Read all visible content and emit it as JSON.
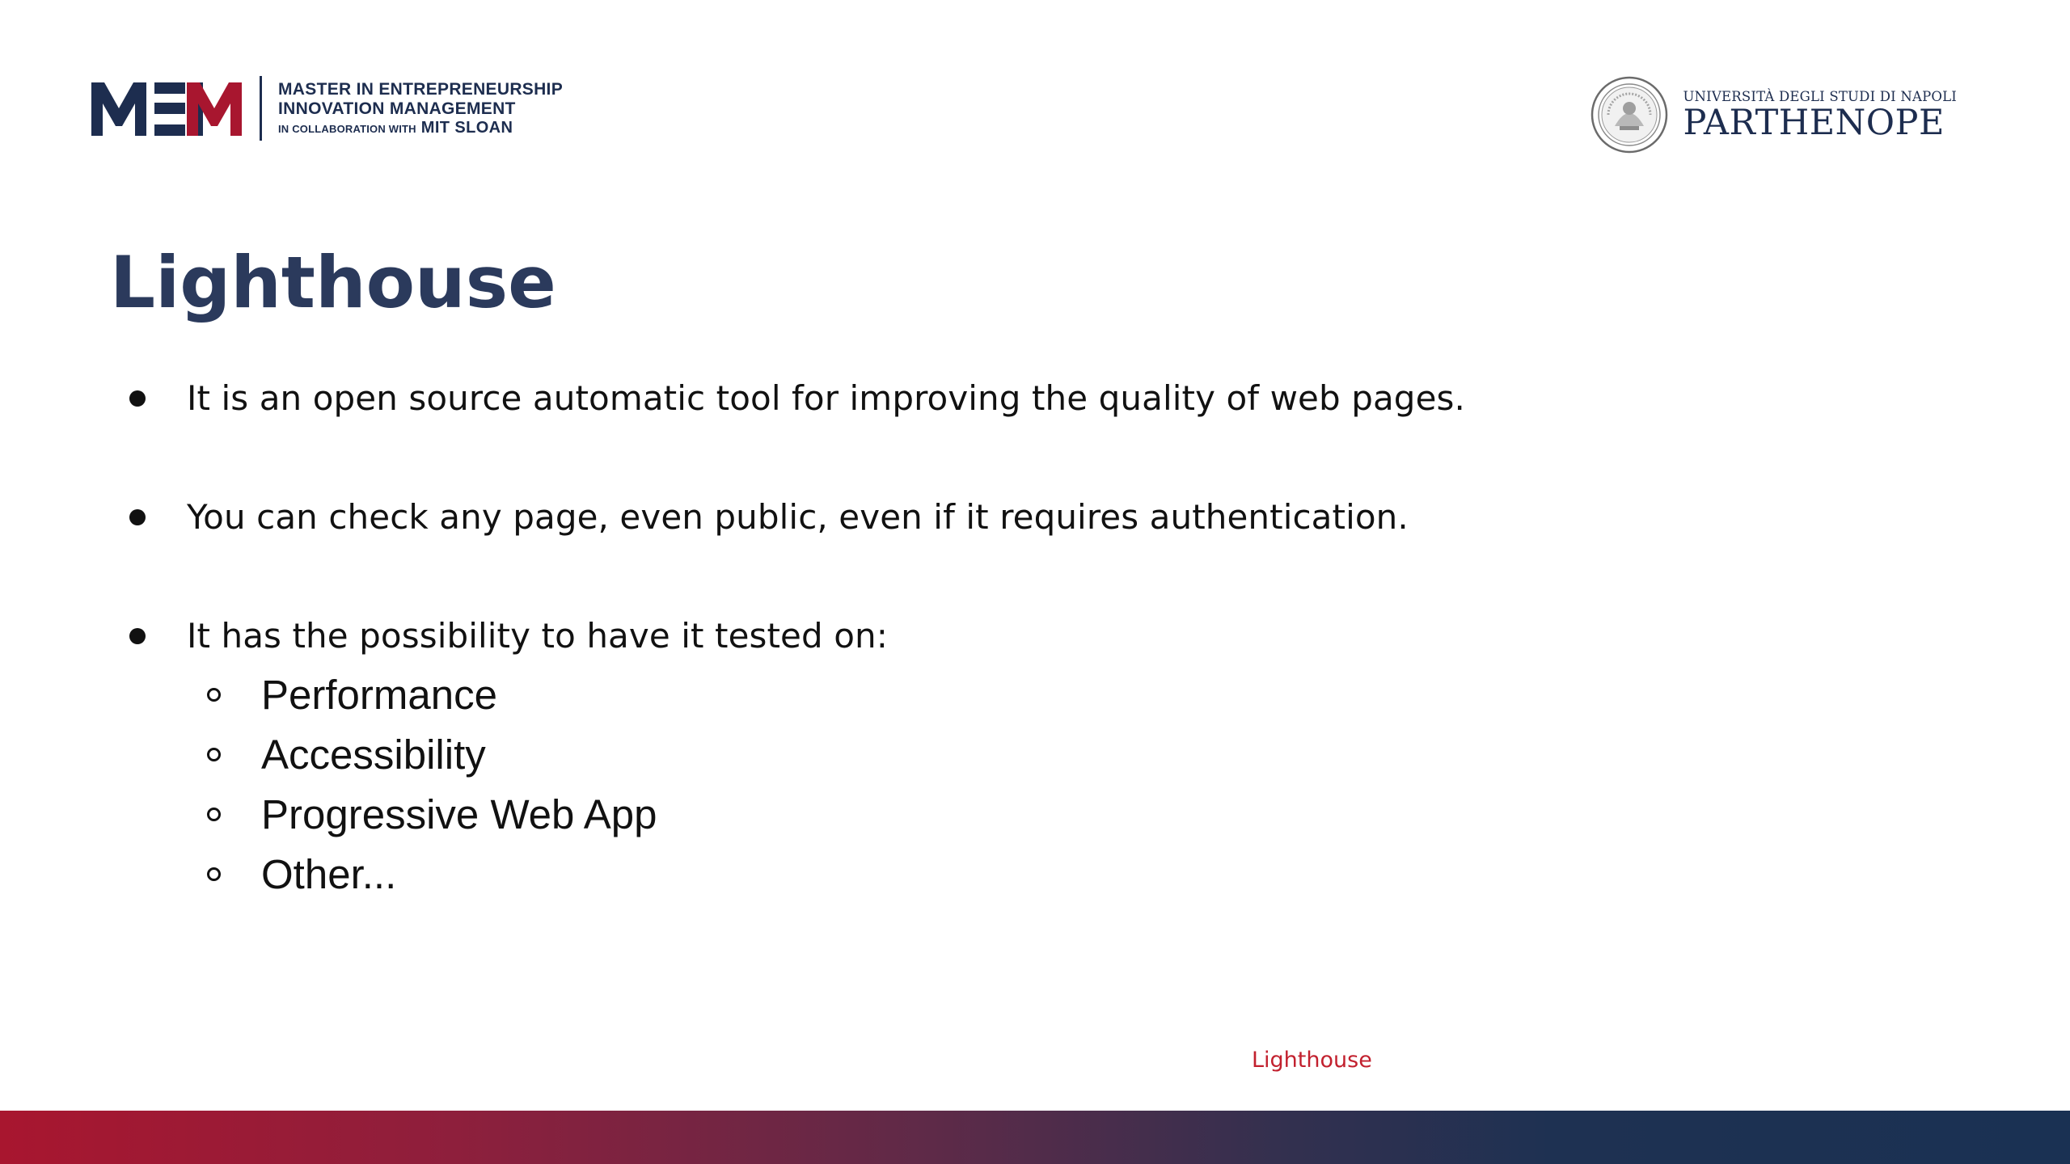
{
  "header": {
    "meim_logo": {
      "mark": "MEIM",
      "line1": "MASTER IN ENTREPRENEURSHIP",
      "line2": "INNOVATION MANAGEMENT",
      "line3_prefix": "IN COLLABORATION WITH",
      "line3_strong": "MIT SLOAN"
    },
    "university_logo": {
      "small": "UNIVERSITÀ DEGLI STUDI DI NAPOLI",
      "big": "PARTHENOPE"
    }
  },
  "slide": {
    "title": "Lighthouse",
    "bullets": [
      "It is an open source automatic tool for improving the quality of web pages.",
      "You can check any page, even public, even if it requires authentication.",
      "It has the possibility to have it tested on:"
    ],
    "sub_items": [
      "Performance",
      "Accessibility",
      "Progressive Web App",
      "Other..."
    ]
  },
  "footer": {
    "label": "Lighthouse"
  },
  "colors": {
    "navy": "#1d2d4f",
    "title": "#2b3a5c",
    "crimson": "#a8162f",
    "footer_text": "#c2202e"
  },
  "icons": {
    "meim": "meim-wordmark",
    "seal": "university-seal-icon"
  }
}
